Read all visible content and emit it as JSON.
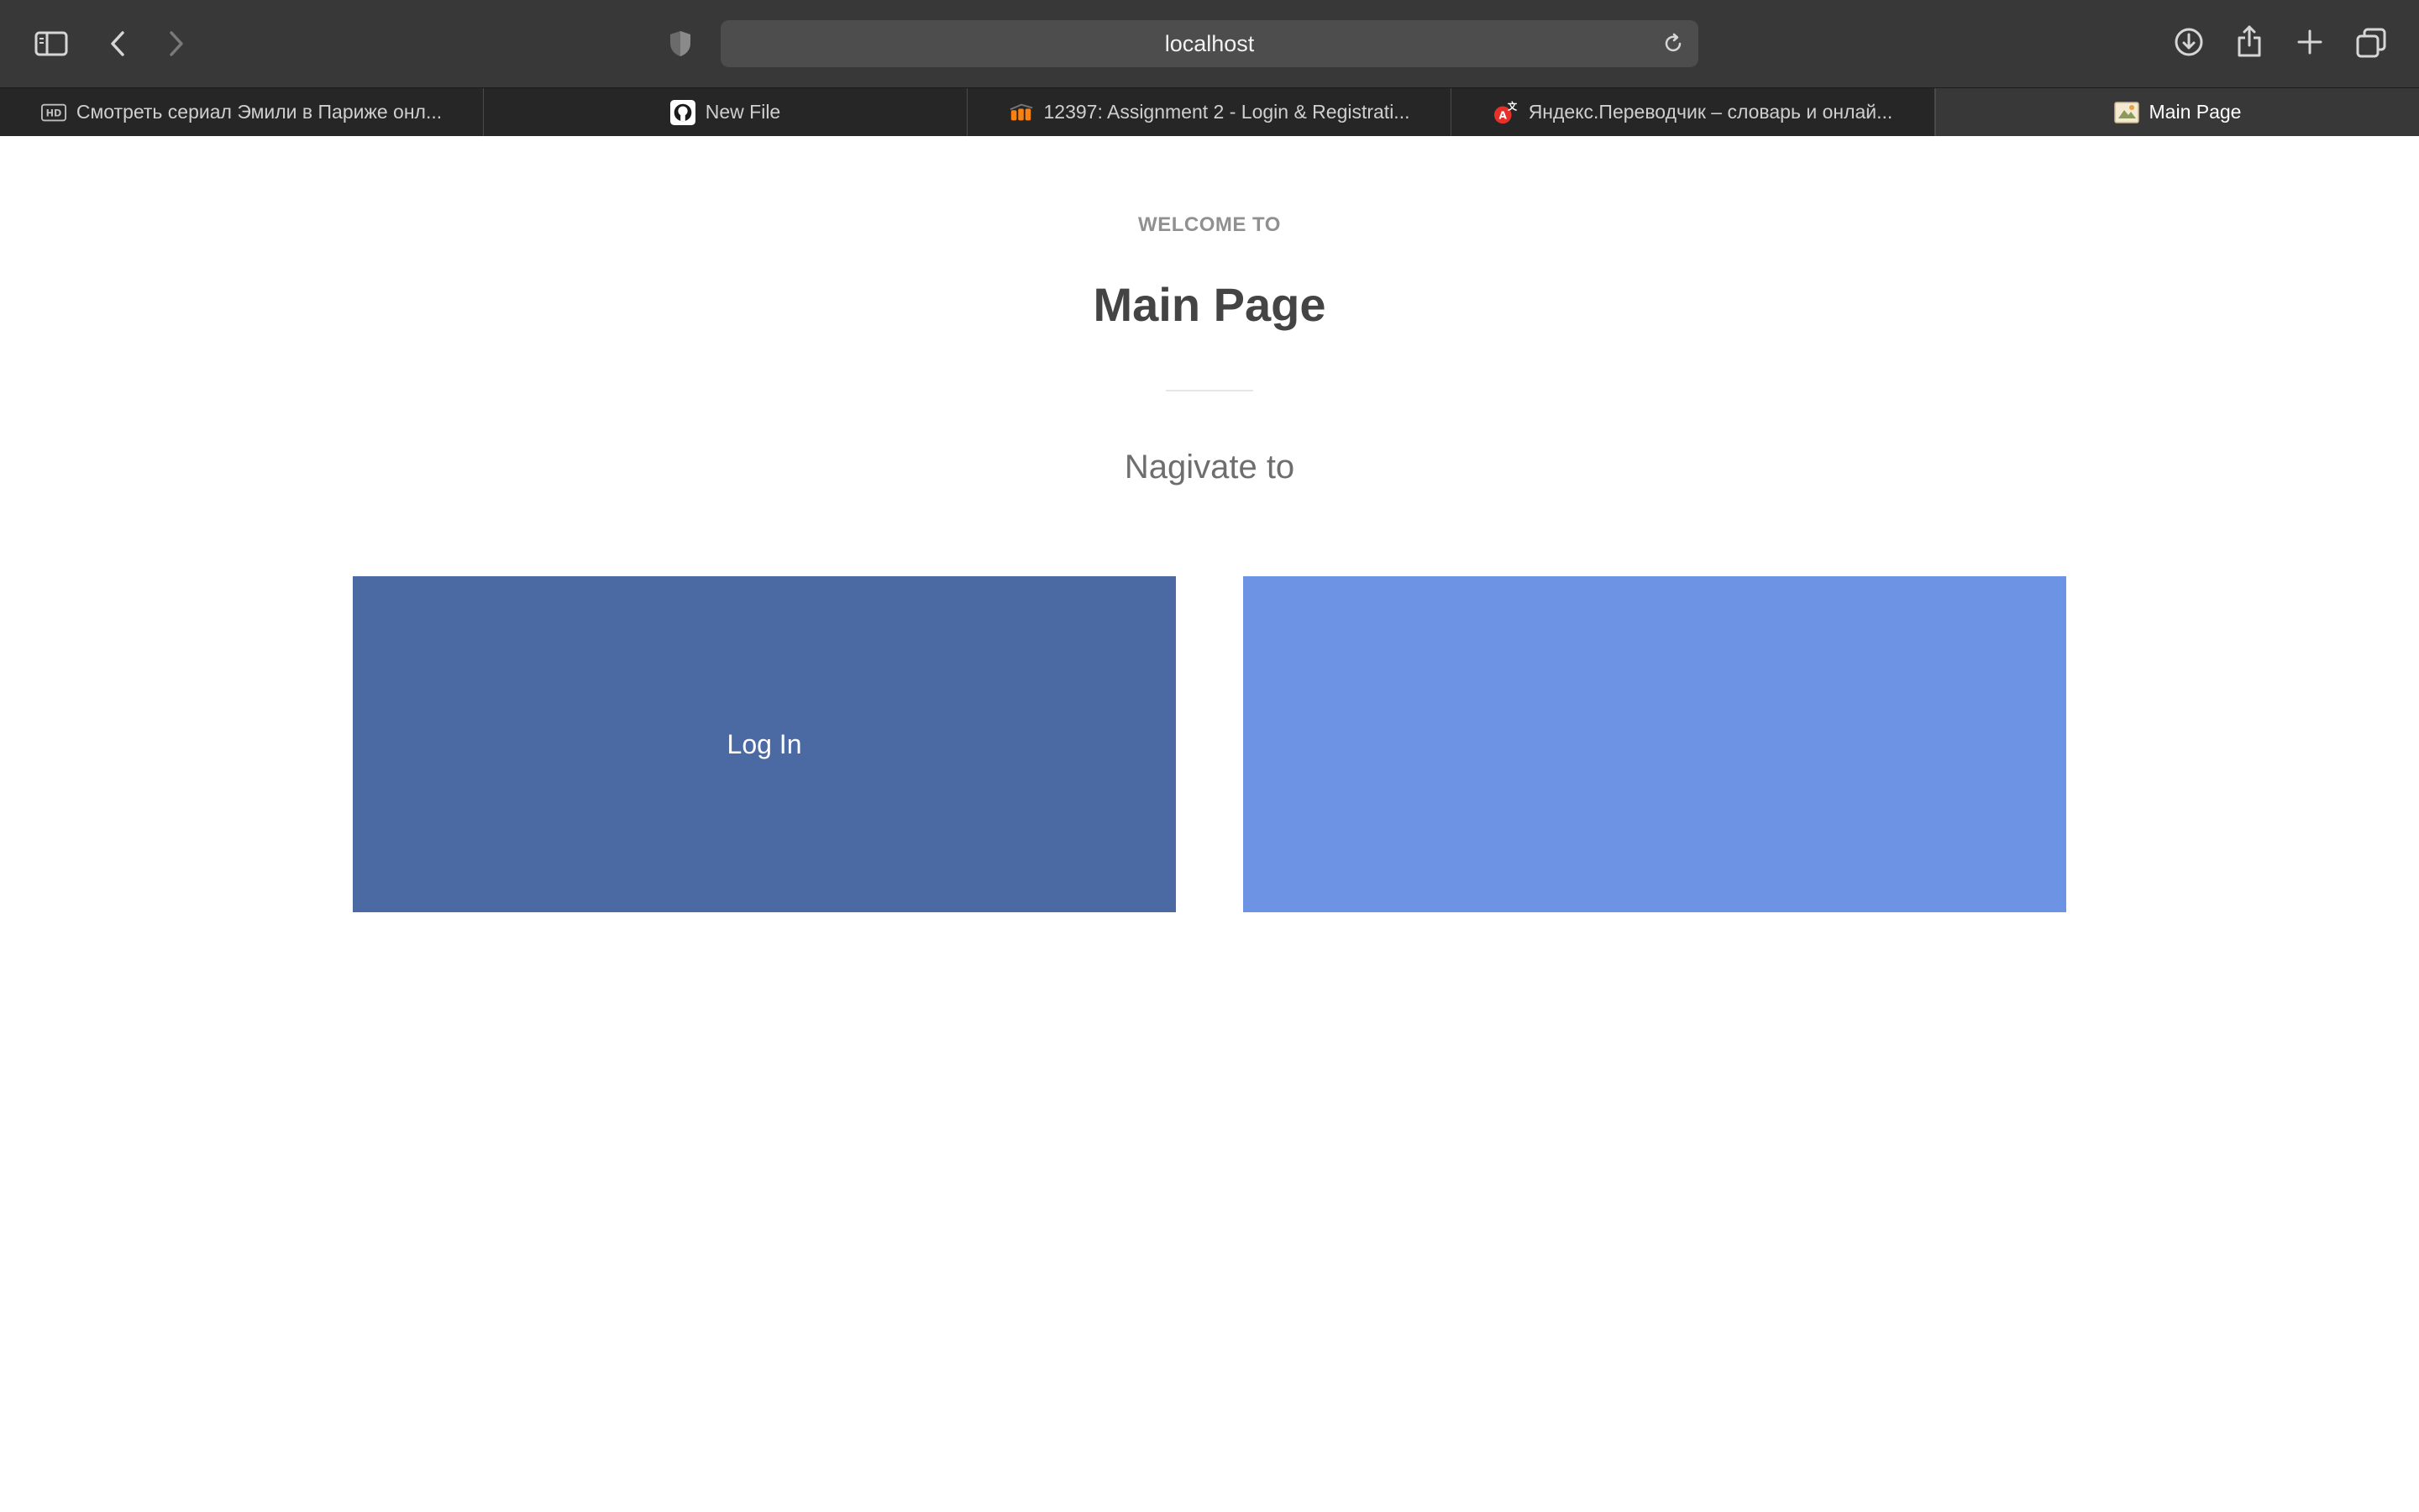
{
  "browser": {
    "url": "localhost",
    "tabs": [
      {
        "label": "Смотреть сериал Эмили в Париже онл...",
        "favicon": "hd-icon"
      },
      {
        "label": "New File",
        "favicon": "github-icon"
      },
      {
        "label": "12397: Assignment 2 - Login & Registrati...",
        "favicon": "moodle-icon"
      },
      {
        "label": "Яндекс.Переводчик – словарь и онлай...",
        "favicon": "yandex-translate-icon"
      },
      {
        "label": "Main Page",
        "favicon": "page-icon",
        "active": true
      }
    ],
    "toolbar_icons": [
      "sidebar-icon",
      "back-icon",
      "forward-icon",
      "shield-icon",
      "reload-icon",
      "download-icon",
      "share-icon",
      "new-tab-icon",
      "tab-overview-icon"
    ]
  },
  "page": {
    "eyebrow": "WELCOME TO",
    "title": "Main Page",
    "subtitle": "Nagivate to",
    "cards": [
      {
        "label": "Log In",
        "color": "#4b69a3"
      },
      {
        "label": "",
        "color": "#6d94e4"
      }
    ]
  }
}
